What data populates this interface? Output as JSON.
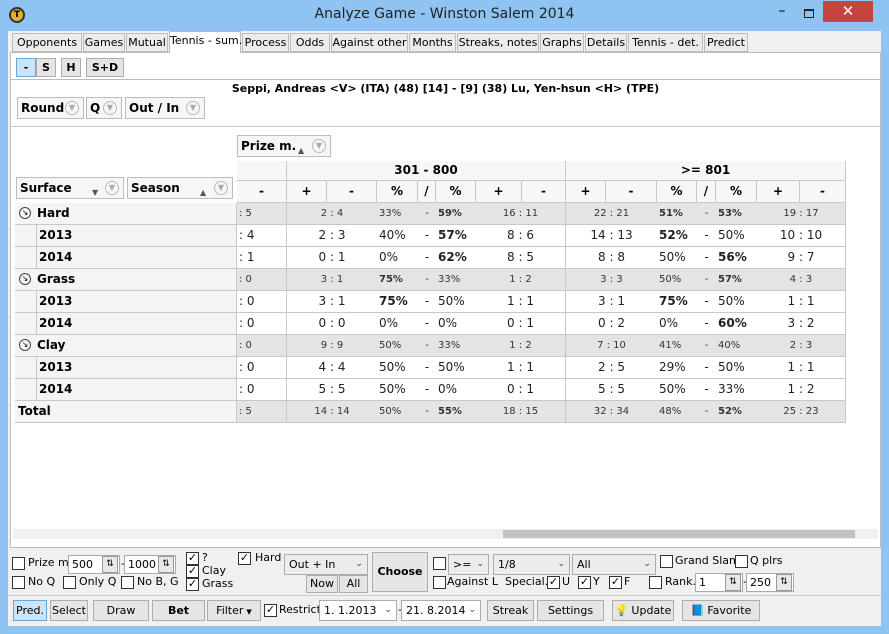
{
  "window": {
    "title": "Analyze Game - Winston Salem 2014",
    "minimize": "–",
    "close": "✕"
  },
  "tabs": [
    "Opponents",
    "Games",
    "Mutual",
    "Tennis - sum.",
    "Process",
    "Odds",
    "Against other",
    "Months",
    "Streaks, notes",
    "Graphs",
    "Details",
    "Tennis - det.",
    "Predict"
  ],
  "active_tab": "Tennis - sum.",
  "type_buttons": [
    "-",
    "S",
    "H",
    "S+D"
  ],
  "active_type": "-",
  "match_title": "Seppi, Andreas <V> (ITA) (48) [14] - [9] (38) Lu, Yen-hsun <H> (TPE)",
  "filters": {
    "round": "Round",
    "q": "Q",
    "out_in": "Out / In",
    "prize": "Prize m.",
    "surface": "Surface",
    "season": "Season"
  },
  "table": {
    "first_col": "-",
    "groups": [
      "301 - 800",
      ">= 801"
    ],
    "subheaders": [
      "+",
      "-",
      "%",
      "/",
      "%",
      "+",
      "-"
    ],
    "rows": [
      {
        "label": "Hard",
        "level": 0,
        "c0": ": 5",
        "g": [
          [
            "2 : 4",
            "33%",
            "-",
            "59%",
            "16 : 11"
          ],
          [
            "22 : 21",
            "51%",
            "-",
            "53%",
            "19 : 17"
          ]
        ],
        "bold": [
          [
            0,
            1
          ],
          [
            1,
            1
          ]
        ]
      },
      {
        "label": "2013",
        "level": 1,
        "c0": ": 4",
        "g": [
          [
            "2 : 3",
            "40%",
            "-",
            "57%",
            "8 : 6"
          ],
          [
            "14 : 13",
            "52%",
            "-",
            "50%",
            "10 : 10"
          ]
        ],
        "bold": [
          [
            0,
            1
          ],
          [
            1,
            0
          ]
        ]
      },
      {
        "label": "2014",
        "level": 1,
        "c0": ": 1",
        "g": [
          [
            "0 : 1",
            "0%",
            "-",
            "62%",
            "8 : 5"
          ],
          [
            "8 : 8",
            "50%",
            "-",
            "56%",
            "9 : 7"
          ]
        ],
        "bold": [
          [
            0,
            1
          ],
          [
            0,
            1
          ]
        ]
      },
      {
        "label": "Grass",
        "level": 0,
        "c0": ": 0",
        "g": [
          [
            "3 : 1",
            "75%",
            "-",
            "33%",
            "1 : 2"
          ],
          [
            "3 : 3",
            "50%",
            "-",
            "57%",
            "4 : 3"
          ]
        ],
        "bold": [
          [
            1,
            0
          ],
          [
            0,
            1
          ]
        ]
      },
      {
        "label": "2013",
        "level": 1,
        "c0": ": 0",
        "g": [
          [
            "3 : 1",
            "75%",
            "-",
            "50%",
            "1 : 1"
          ],
          [
            "3 : 1",
            "75%",
            "-",
            "50%",
            "1 : 1"
          ]
        ],
        "bold": [
          [
            1,
            0
          ],
          [
            1,
            0
          ]
        ]
      },
      {
        "label": "2014",
        "level": 1,
        "c0": ": 0",
        "g": [
          [
            "0 : 0",
            "0%",
            "-",
            "0%",
            "0 : 1"
          ],
          [
            "0 : 2",
            "0%",
            "-",
            "60%",
            "3 : 2"
          ]
        ],
        "bold": [
          [
            0,
            0
          ],
          [
            0,
            1
          ]
        ]
      },
      {
        "label": "Clay",
        "level": 0,
        "c0": ": 0",
        "g": [
          [
            "9 : 9",
            "50%",
            "-",
            "33%",
            "1 : 2"
          ],
          [
            "7 : 10",
            "41%",
            "-",
            "40%",
            "2 : 3"
          ]
        ],
        "bold": [
          [
            0,
            0
          ],
          [
            0,
            0
          ]
        ]
      },
      {
        "label": "2013",
        "level": 1,
        "c0": ": 0",
        "g": [
          [
            "4 : 4",
            "50%",
            "-",
            "50%",
            "1 : 1"
          ],
          [
            "2 : 5",
            "29%",
            "-",
            "50%",
            "1 : 1"
          ]
        ],
        "bold": [
          [
            0,
            0
          ],
          [
            0,
            0
          ]
        ]
      },
      {
        "label": "2014",
        "level": 1,
        "c0": ": 0",
        "g": [
          [
            "5 : 5",
            "50%",
            "-",
            "0%",
            "0 : 1"
          ],
          [
            "5 : 5",
            "50%",
            "-",
            "33%",
            "1 : 2"
          ]
        ],
        "bold": [
          [
            0,
            0
          ],
          [
            0,
            0
          ]
        ]
      },
      {
        "label": "Total",
        "level": -1,
        "c0": ": 5",
        "g": [
          [
            "14 : 14",
            "50%",
            "-",
            "55%",
            "18 : 15"
          ],
          [
            "32 : 34",
            "48%",
            "-",
            "52%",
            "25 : 23"
          ]
        ],
        "bold": [
          [
            0,
            1
          ],
          [
            0,
            1
          ]
        ]
      }
    ]
  },
  "bottom": {
    "prize_money": {
      "label": "Prize mor",
      "checked": false,
      "from": "500",
      "to": "1000"
    },
    "no_q": {
      "label": "No Q",
      "checked": false
    },
    "only_q": {
      "label": "Only Q",
      "checked": false
    },
    "no_bg": {
      "label": "No B, G",
      "checked": false
    },
    "surfaces": [
      {
        "label": "?",
        "checked": true
      },
      {
        "label": "Clay",
        "checked": true
      },
      {
        "label": "Grass",
        "checked": true
      }
    ],
    "hard": {
      "label": "Hard",
      "checked": true
    },
    "out_in_select": "Out + In",
    "now": "Now",
    "all": "All",
    "choose": "Choose",
    "cmp_checked": false,
    "cmp_select": ">=",
    "round_select": "1/8",
    "all_select": "All",
    "grand_slam": {
      "label": "Grand Slam",
      "checked": false
    },
    "q_plrs": {
      "label": "Q plrs",
      "checked": false
    },
    "against_l": {
      "label": "Against L",
      "checked": false
    },
    "special": "Special.",
    "special_flags": [
      {
        "label": "U",
        "checked": true
      },
      {
        "label": "Y",
        "checked": true
      },
      {
        "label": "F",
        "checked": true
      }
    ],
    "rank": {
      "label": "Rank.",
      "checked": false,
      "from": "1",
      "to": "250"
    },
    "buttons": {
      "pred": "Pred.",
      "select": "Select",
      "draw": "Draw",
      "bet": "Bet",
      "filter": "Filter",
      "streak": "Streak",
      "settings": "Settings",
      "update": "Update",
      "favorite": "Favorite"
    },
    "restrict": {
      "label": "Restrict",
      "checked": true,
      "from": "1.  1.2013",
      "to": "21.  8.2014"
    }
  },
  "colors": {
    "window_frame": "#8ec3f2",
    "close_button": "#c7433e",
    "group_row": "#e4e4e4",
    "active_button": "#cce4f7"
  }
}
